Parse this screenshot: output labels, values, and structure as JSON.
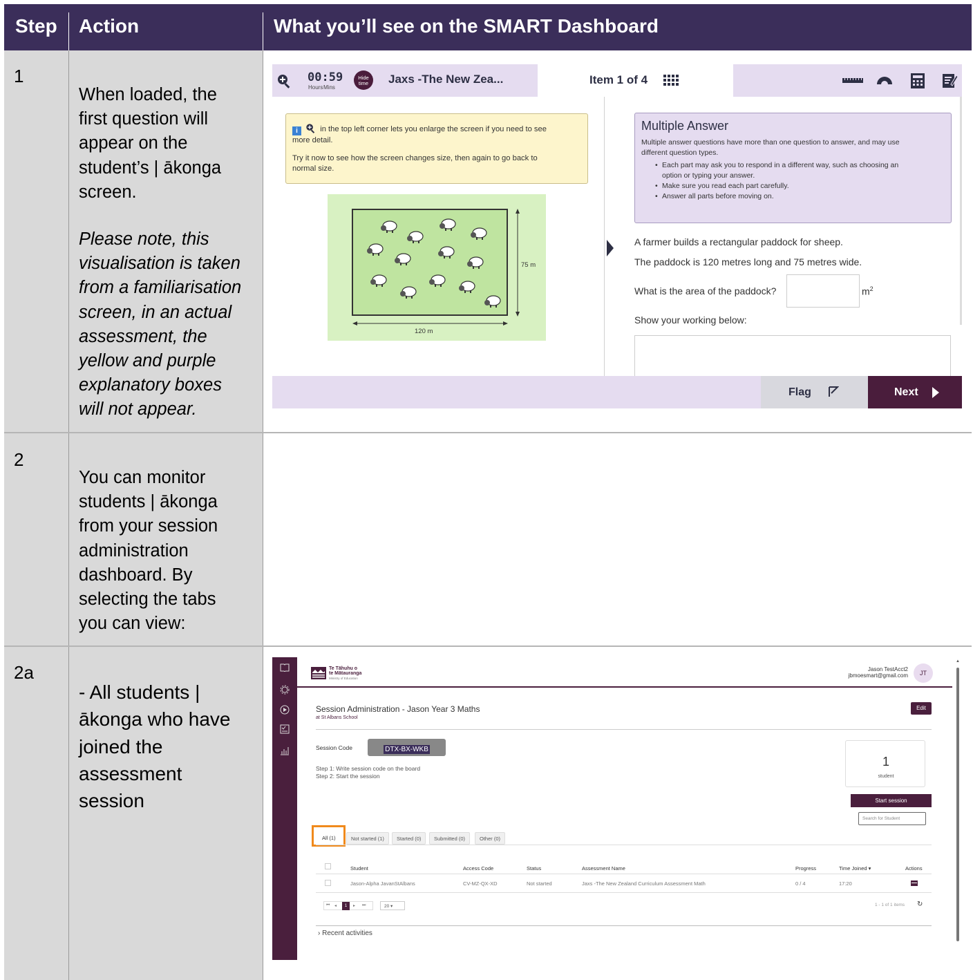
{
  "header": {
    "step": "Step",
    "action": "Action",
    "view": "What you’ll see on the SMART Dashboard"
  },
  "rows": [
    {
      "step": "1",
      "action_lines": [
        "When loaded, the",
        "first question will",
        "appear on the",
        "student’s | ākonga",
        "screen."
      ],
      "note_lines": [
        "Please note, this",
        "visualisation is taken",
        "from a familiarisation",
        "screen, in an actual",
        "assessment, the",
        "yellow and purple",
        "explanatory boxes",
        "will not appear."
      ]
    },
    {
      "step": "2",
      "action_lines": [
        "You can monitor",
        "students | ākonga",
        "from your session",
        "administration",
        "dashboard. By",
        "selecting the tabs",
        "you can view:"
      ]
    },
    {
      "step": "2a",
      "action_lines": [
        "- All students |",
        "ākonga who have",
        "joined the",
        "assessment",
        "session"
      ]
    }
  ],
  "assessment": {
    "timer": "00:59",
    "timer_hours": "Hours",
    "timer_mins": "Mins",
    "hide_time": "Hide time",
    "title": "Jaxs -The New Zea...",
    "item": "Item 1 of 4",
    "yellow_line1": "in the top left corner lets you enlarge the screen if you need to see",
    "yellow_line2": "more detail.",
    "yellow_line3": "Try it now to see how the screen changes size, then again to go back to",
    "yellow_line4": "normal size.",
    "purple_title": "Multiple Answer",
    "purple_intro1": "Multiple answer questions have more than one question to answer, and may use",
    "purple_intro2": "different question types.",
    "purple_b1a": "Each part may ask you to respond in a different way, such as choosing an",
    "purple_b1b": "option or typing your answer.",
    "purple_b2": "Make sure you read each part carefully.",
    "purple_b3": "Answer all parts before moving on.",
    "q1": "A farmer builds a rectangular paddock for sheep.",
    "q2": "The paddock is 120 metres long and 75 metres wide.",
    "q3": "What is the area of the paddock?",
    "unit": "m",
    "unit_sup": "2",
    "q4": "Show your working below:",
    "height_label": "75 m",
    "width_label": "120 m",
    "flag": "Flag",
    "next": "Next"
  },
  "dashboard": {
    "org1": "Te Tāhuhu o",
    "org2": "te Mātauranga",
    "org3": "Ministry of Education",
    "user_name": "Jason TestAcct2",
    "user_email": "jbmoesmart@gmail.com",
    "avatar": "JT",
    "session_title": "Session Administration - Jason Year 3 Maths",
    "school": "at St Albans School",
    "edit": "Edit",
    "session_code_label": "Session Code",
    "session_code": "DTX-BX-WKB",
    "step1": "Step 1: Write session code on the board",
    "step2": "Step 2: Start the session",
    "student_count": "1",
    "student_label": "student",
    "start_session": "Start session",
    "search_placeholder": "Search for Student",
    "tabs": [
      "All (1)",
      "Not started (1)",
      "Started (0)",
      "Submitted (0)",
      "Other (0)"
    ],
    "columns": [
      "Student",
      "Access Code",
      "Status",
      "Assessment Name",
      "Progress",
      "Time Joined ▾",
      "Actions"
    ],
    "row": {
      "student": "Jason-Alpha JavanStAlbans",
      "access_code": "CV-MZ-QX-XD",
      "status": "Not started",
      "assessment": "Jaxs -The New Zealand Curriculum Assessment Math",
      "progress": "0 / 4",
      "time": "17:20"
    },
    "page": "1",
    "page_size": "20",
    "items_info": "1 - 1 of 1 items",
    "recent": "Recent activities"
  },
  "colors": {
    "header_bg": "#3b2e5a",
    "step_bg": "#d9d9d9",
    "sidebar": "#4a1f3d",
    "highlight": "#f08a1c"
  }
}
